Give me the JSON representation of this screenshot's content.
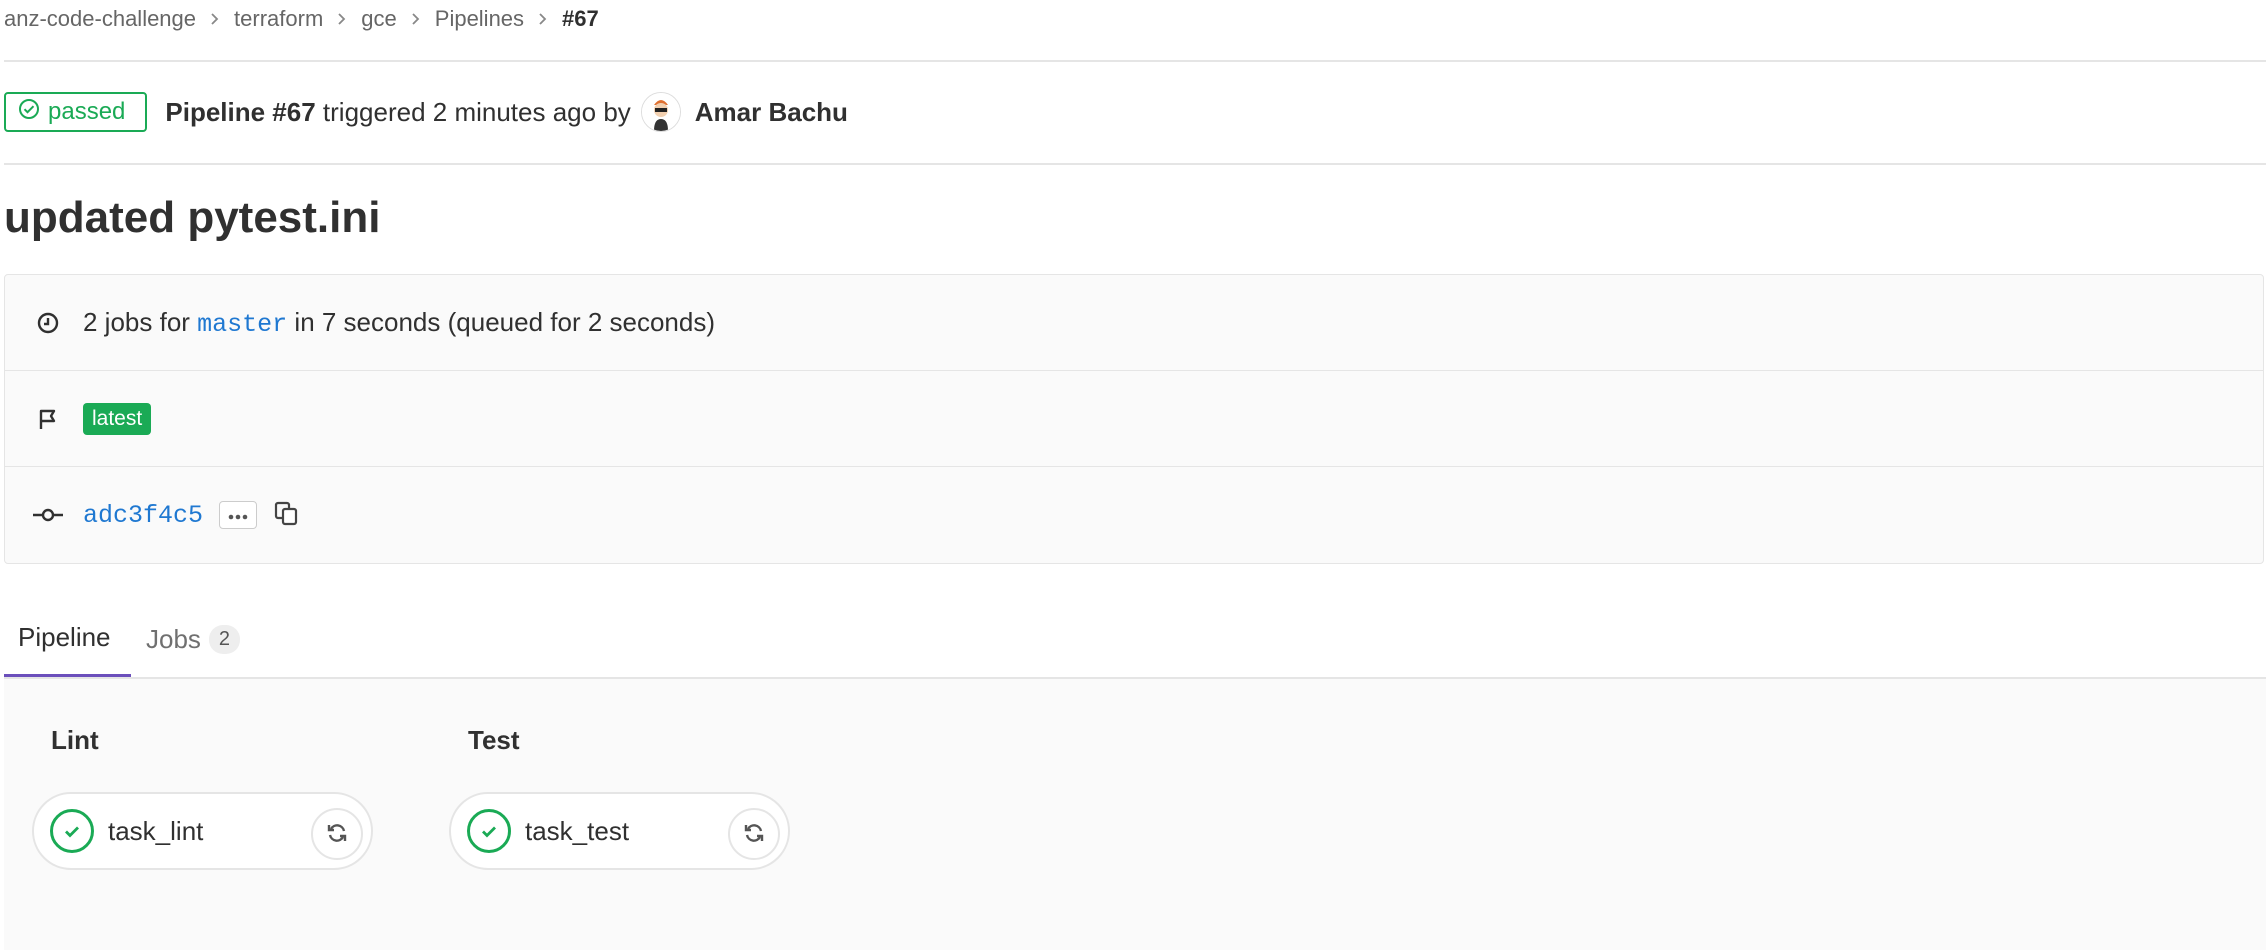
{
  "breadcrumb": [
    "anz-code-challenge",
    "terraform",
    "gce",
    "Pipelines",
    "#67"
  ],
  "header": {
    "status": "passed",
    "pipeline_label": "Pipeline #67",
    "triggered_text": " triggered 2 minutes ago by",
    "author": "Amar Bachu"
  },
  "commit_title": "updated pytest.ini",
  "info": {
    "jobs_prefix": "2 jobs for ",
    "branch": "master",
    "jobs_suffix": " in 7 seconds (queued for 2 seconds)",
    "badge": "latest",
    "sha": "adc3f4c5"
  },
  "tabs": {
    "pipeline": "Pipeline",
    "jobs": "Jobs",
    "jobs_count": "2"
  },
  "stages": [
    {
      "title": "Lint",
      "job": "task_lint",
      "status": "passed"
    },
    {
      "title": "Test",
      "job": "task_test",
      "status": "passed"
    }
  ],
  "colors": {
    "success": "#1aaa55",
    "link": "#1f78d1",
    "active_tab": "#6b4fbb"
  },
  "icons": [
    "check-circle-icon",
    "clock-icon",
    "flag-icon",
    "commit-icon",
    "ellipsis-icon",
    "copy-icon",
    "check-icon",
    "retry-icon",
    "chevron-right-icon"
  ]
}
